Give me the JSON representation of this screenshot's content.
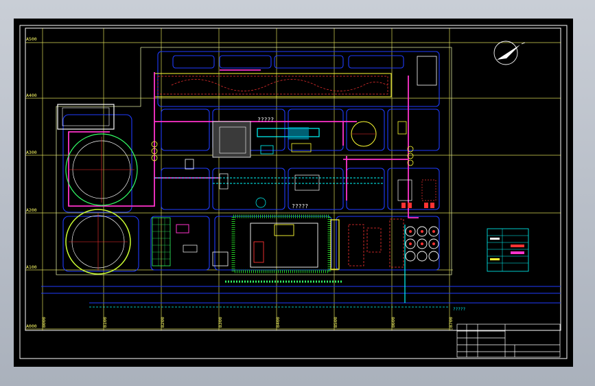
{
  "axes": {
    "y_labels": [
      "A500",
      "A400",
      "A300",
      "A200",
      "A100",
      "A000"
    ],
    "x_labels": [
      "B000",
      "B100",
      "B200",
      "B300",
      "B400",
      "B500",
      "B600",
      "B700"
    ]
  },
  "callouts": {
    "main_plant": "?????",
    "lower_building": "?????",
    "road_note": "?????"
  },
  "colors": {
    "background": "#000000",
    "frame": "#ffffff",
    "grid": "#ffff66",
    "road": "#1f3cff",
    "pipe": "#ff33cc",
    "tank": "#66ff33",
    "dashed": "#ff3333",
    "equipment": "#00ffff"
  },
  "icons": {
    "north_arrow": "compass-north-arrow-icon"
  }
}
